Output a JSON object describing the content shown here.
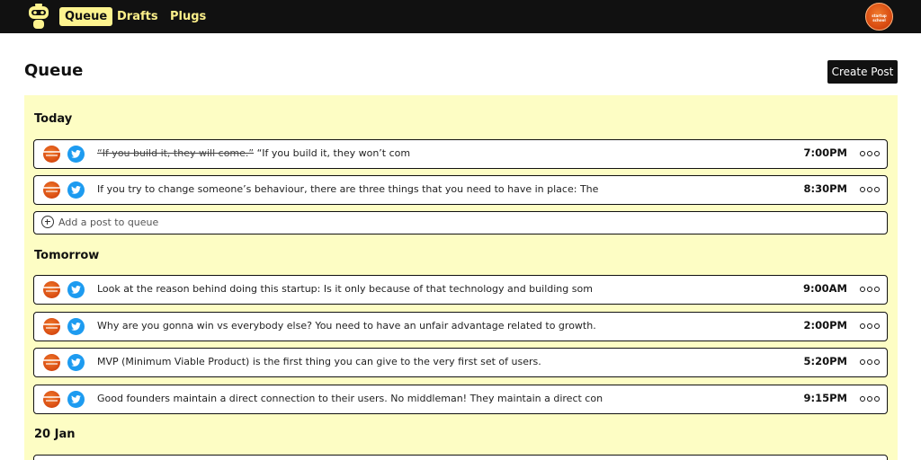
{
  "nav": {
    "items": [
      {
        "label": "Queue",
        "active": true
      },
      {
        "label": "Drafts",
        "active": false
      },
      {
        "label": "Plugs",
        "active": false
      }
    ],
    "avatar_text": [
      "startup",
      "school"
    ]
  },
  "header": {
    "title": "Queue",
    "create_label": "Create Post"
  },
  "colors": {
    "accent": "#fdf38f",
    "panel": "#fdfdc4",
    "twitter": "#1d9bf0",
    "topbar": "#111111"
  },
  "sections": [
    {
      "title": "Today",
      "posts": [
        {
          "struck": "“If you build it, they will come.”",
          "text": " “If you build it, they won’t com",
          "time": "7:00PM"
        },
        {
          "struck": "",
          "text": "If you try to change someone’s behaviour, there are three things that you need to have in place: The",
          "time": "8:30PM"
        }
      ],
      "add_label": "Add a post to queue"
    },
    {
      "title": "Tomorrow",
      "posts": [
        {
          "struck": "",
          "text": "Look at the reason behind doing this startup: Is it only because of that technology and building som",
          "time": "9:00AM"
        },
        {
          "struck": "",
          "text": "Why are you gonna win vs everybody else? You need to have an unfair advantage related to growth.",
          "time": "2:00PM"
        },
        {
          "struck": "",
          "text": "MVP (Minimum Viable Product) is the first thing you can give to the very first set of users.",
          "time": "5:20PM"
        },
        {
          "struck": "",
          "text": "Good founders maintain a direct connection to their users. No middleman! They maintain a direct con",
          "time": "9:15PM"
        }
      ]
    },
    {
      "title": "20 Jan",
      "posts": []
    }
  ]
}
